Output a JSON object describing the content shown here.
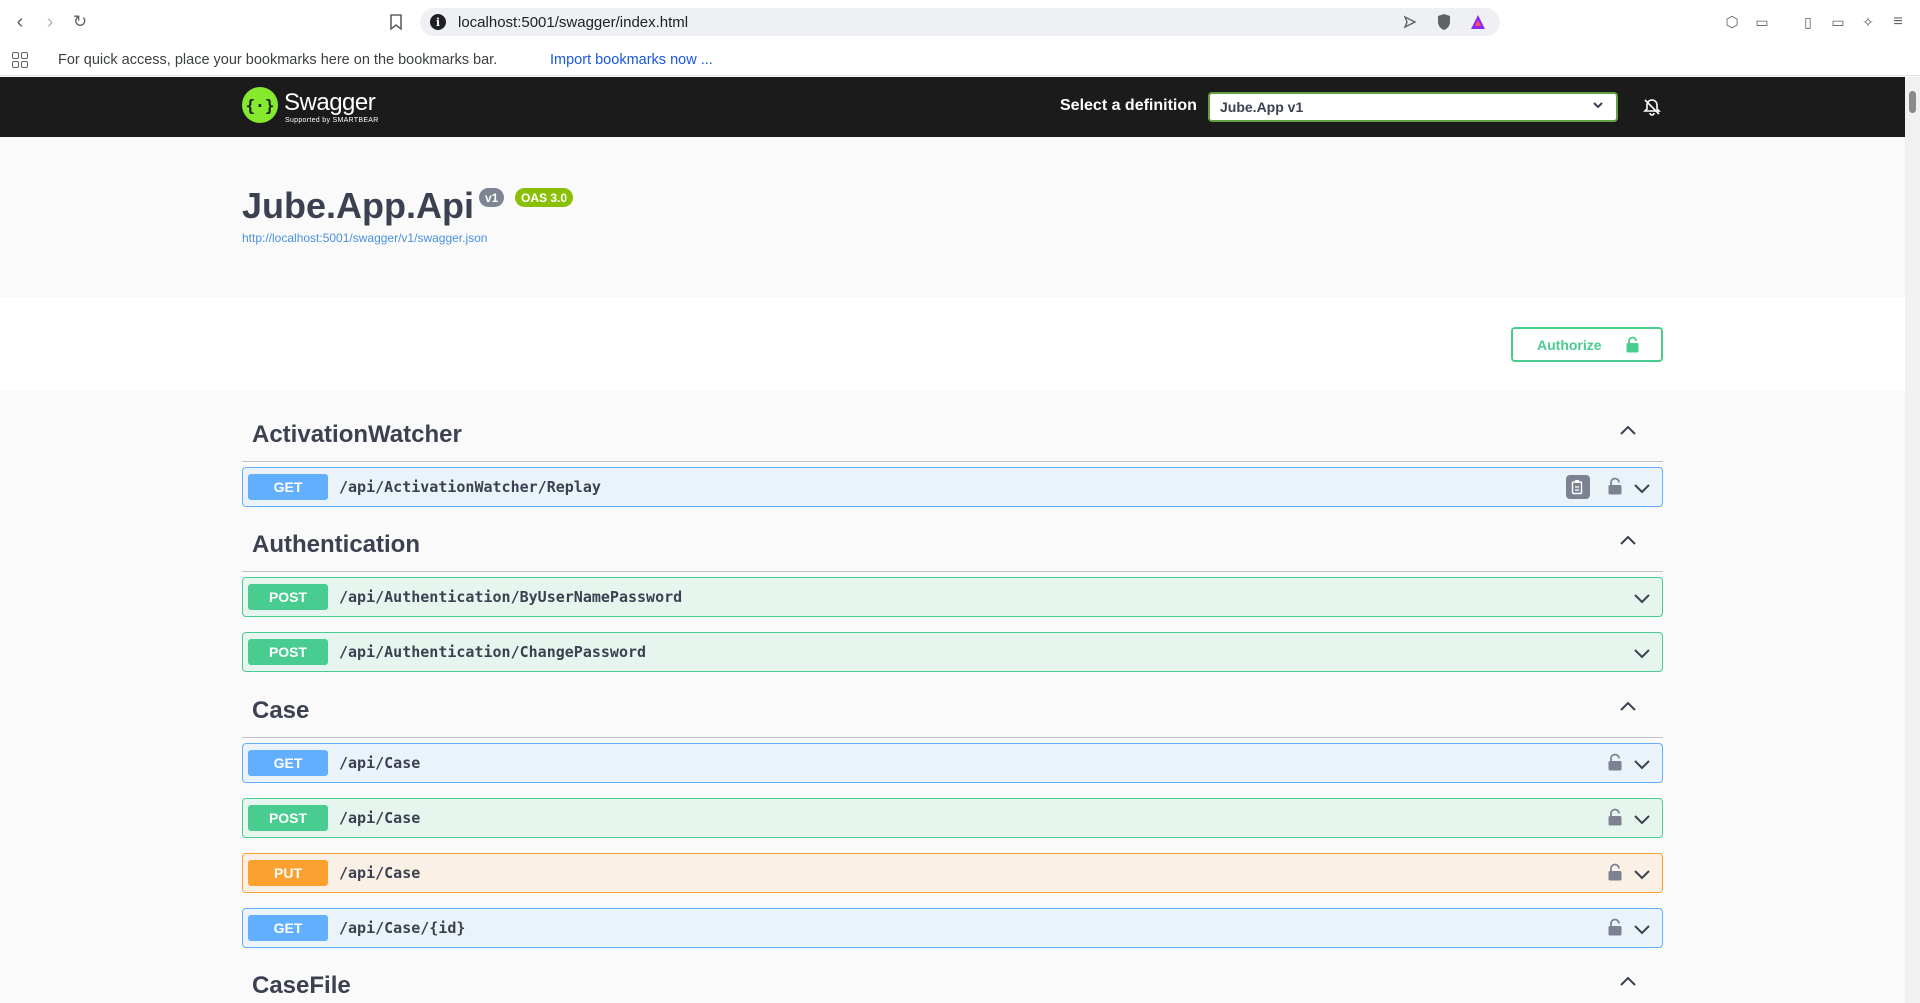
{
  "browser": {
    "url": "localhost:5001/swagger/index.html",
    "bookmarks_message": "For quick access, place your bookmarks here on the bookmarks bar.",
    "bookmarks_link": "Import bookmarks now ..."
  },
  "topbar": {
    "logo_text": "Swagger",
    "logo_sub": "Supported by SMARTBEAR",
    "select_label": "Select a definition",
    "selected_definition": "Jube.App v1"
  },
  "info": {
    "title": "Jube.App.Api",
    "version_badge": "v1",
    "oas_badge": "OAS 3.0",
    "spec_url": "http://localhost:5001/swagger/v1/swagger.json"
  },
  "scheme": {
    "authorize_label": "Authorize"
  },
  "tags": [
    {
      "name": "ActivationWatcher",
      "operations": [
        {
          "method": "GET",
          "path": "/api/ActivationWatcher/Replay"
        }
      ]
    },
    {
      "name": "Authentication",
      "operations": [
        {
          "method": "POST",
          "path": "/api/Authentication/ByUserNamePassword"
        },
        {
          "method": "POST",
          "path": "/api/Authentication/ChangePassword"
        }
      ]
    },
    {
      "name": "Case",
      "operations": [
        {
          "method": "GET",
          "path": "/api/Case"
        },
        {
          "method": "POST",
          "path": "/api/Case"
        },
        {
          "method": "PUT",
          "path": "/api/Case"
        },
        {
          "method": "GET",
          "path": "/api/Case/{id}"
        }
      ]
    },
    {
      "name": "CaseFile",
      "operations": []
    }
  ],
  "colors": {
    "get": "#61affe",
    "post": "#49cc90",
    "put": "#fca130",
    "topbar": "#1b1b1b",
    "logo": "#85ea2d"
  }
}
